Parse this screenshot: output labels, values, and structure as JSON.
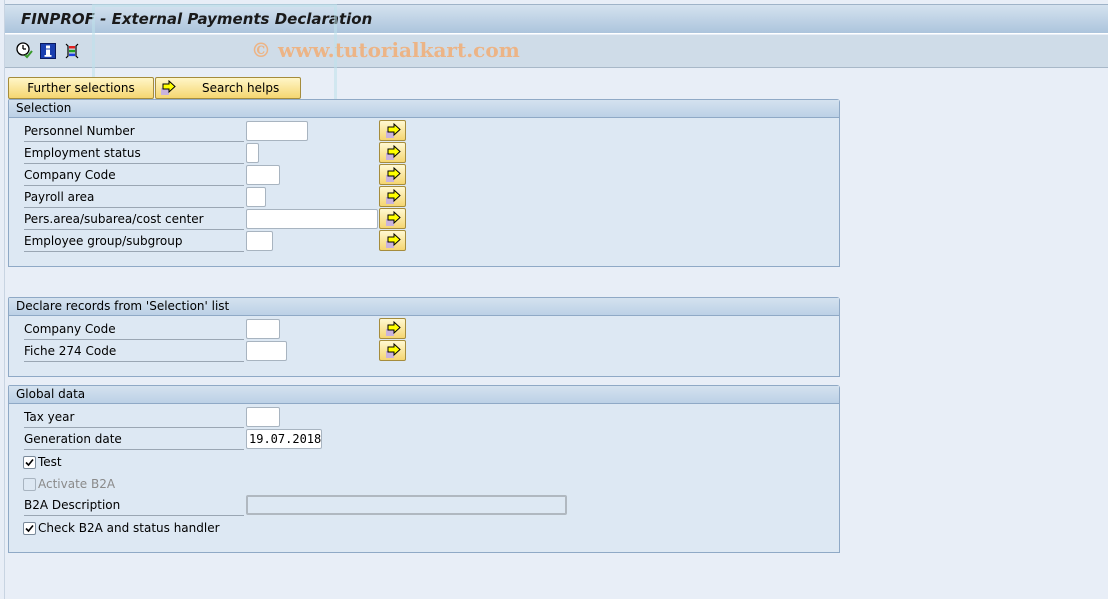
{
  "window": {
    "title": "FINPROF - External Payments Declaration"
  },
  "toolbar": {
    "icons": [
      {
        "name": "execute-clock-icon",
        "tooltip": "Execute"
      },
      {
        "name": "info-icon",
        "tooltip": "Program documentation"
      },
      {
        "name": "selection-options-icon",
        "tooltip": "Selection options"
      }
    ]
  },
  "watermark": "© www.tutorialkart.com",
  "buttons": {
    "further_selections": "Further selections",
    "search_helps": "Search helps"
  },
  "sections": {
    "selection": {
      "title": "Selection",
      "fields": [
        {
          "label": "Personnel Number",
          "value": ""
        },
        {
          "label": "Employment status",
          "value": ""
        },
        {
          "label": "Company Code",
          "value": ""
        },
        {
          "label": "Payroll area",
          "value": ""
        },
        {
          "label": "Pers.area/subarea/cost center",
          "value": ""
        },
        {
          "label": "Employee group/subgroup",
          "value": ""
        }
      ]
    },
    "declare": {
      "title": "Declare records from 'Selection' list",
      "fields": [
        {
          "label": "Company Code",
          "value": ""
        },
        {
          "label": "Fiche 274 Code",
          "value": ""
        }
      ]
    },
    "global": {
      "title": "Global data",
      "tax_year": {
        "label": "Tax year",
        "value": ""
      },
      "generation_date": {
        "label": "Generation date",
        "value": "19.07.2018"
      },
      "test": {
        "label": "Test",
        "checked": true
      },
      "activate_b2a": {
        "label": "Activate B2A",
        "checked": false,
        "disabled": true
      },
      "b2a_description": {
        "label": "B2A Description",
        "value": ""
      },
      "check_b2a": {
        "label": "Check B2A and status handler",
        "checked": true
      }
    }
  }
}
